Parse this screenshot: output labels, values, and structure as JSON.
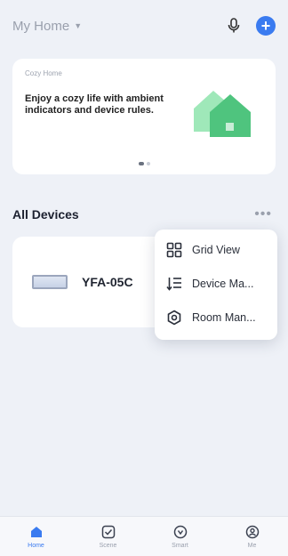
{
  "header": {
    "home_name": "My Home",
    "mic_icon": "microphone-icon",
    "add_icon": "plus-icon",
    "accent": "#3a7bf0"
  },
  "banner": {
    "tag": "Cozy Home",
    "text": "Enjoy a cozy life with ambient indicators and device rules.",
    "art_icon": "home-illustration",
    "art_color": "#5fcf8a"
  },
  "devices_section": {
    "title": "All Devices",
    "more_label": "•••"
  },
  "devices": [
    {
      "name": "YFA-05C",
      "icon": "air-conditioner-icon"
    }
  ],
  "menu": {
    "items": [
      {
        "label": "Grid View",
        "icon": "grid-icon"
      },
      {
        "label": "Device Ma...",
        "icon": "sort-list-icon"
      },
      {
        "label": "Room Man...",
        "icon": "settings-icon"
      }
    ]
  },
  "tabbar": {
    "tabs": [
      {
        "label": "Home",
        "icon": "home-icon",
        "active": true
      },
      {
        "label": "Scene",
        "icon": "scene-icon",
        "active": false
      },
      {
        "label": "Smart",
        "icon": "smart-icon",
        "active": false
      },
      {
        "label": "Me",
        "icon": "profile-icon",
        "active": false
      }
    ]
  }
}
